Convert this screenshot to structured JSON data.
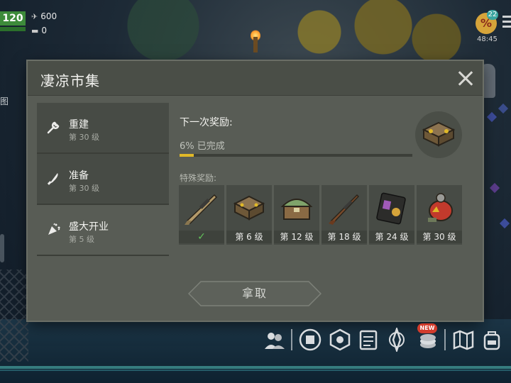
{
  "hud": {
    "level": "120",
    "resource_1": "600",
    "resource_2": "0",
    "discount_symbol": "%",
    "discount_count": "22",
    "time": "48:45",
    "map_label": "图"
  },
  "modal": {
    "title": "凄凉市集"
  },
  "sidebar": {
    "items": [
      {
        "name": "重建",
        "level": "第 30 级",
        "icon": "wrench-icon"
      },
      {
        "name": "准备",
        "level": "第 30 级",
        "icon": "knife-icon"
      },
      {
        "name": "盛大开业",
        "level": "第 5 级",
        "icon": "confetti-icon"
      }
    ]
  },
  "panel": {
    "next_reward_label": "下一次奖励:",
    "progress_text": "6% 已完成",
    "progress_value": 0.06,
    "progress_color": "#e0b928",
    "special_rewards_label": "特殊奖励:",
    "rewards": [
      {
        "label": "",
        "claimed": true,
        "icon": "scoped-rifle-icon"
      },
      {
        "label": "第 6 级",
        "claimed": false,
        "icon": "supply-crate-icon"
      },
      {
        "label": "第 12 级",
        "claimed": false,
        "icon": "green-crate-icon"
      },
      {
        "label": "第 18 级",
        "claimed": false,
        "icon": "hunting-rifle-icon"
      },
      {
        "label": "第 24 级",
        "claimed": false,
        "icon": "id-card-icon"
      },
      {
        "label": "第 30 级",
        "claimed": false,
        "icon": "red-backpack-icon"
      }
    ],
    "check_mark": "✓"
  },
  "claim_button": {
    "label": "拿取"
  },
  "toolbar": {
    "new_badge": "NEW",
    "icons": [
      "friends-icon",
      "clan-icon",
      "crafting-icon",
      "tasks-icon",
      "events-icon",
      "coins-icon",
      "map-icon",
      "backpack-icon"
    ]
  }
}
